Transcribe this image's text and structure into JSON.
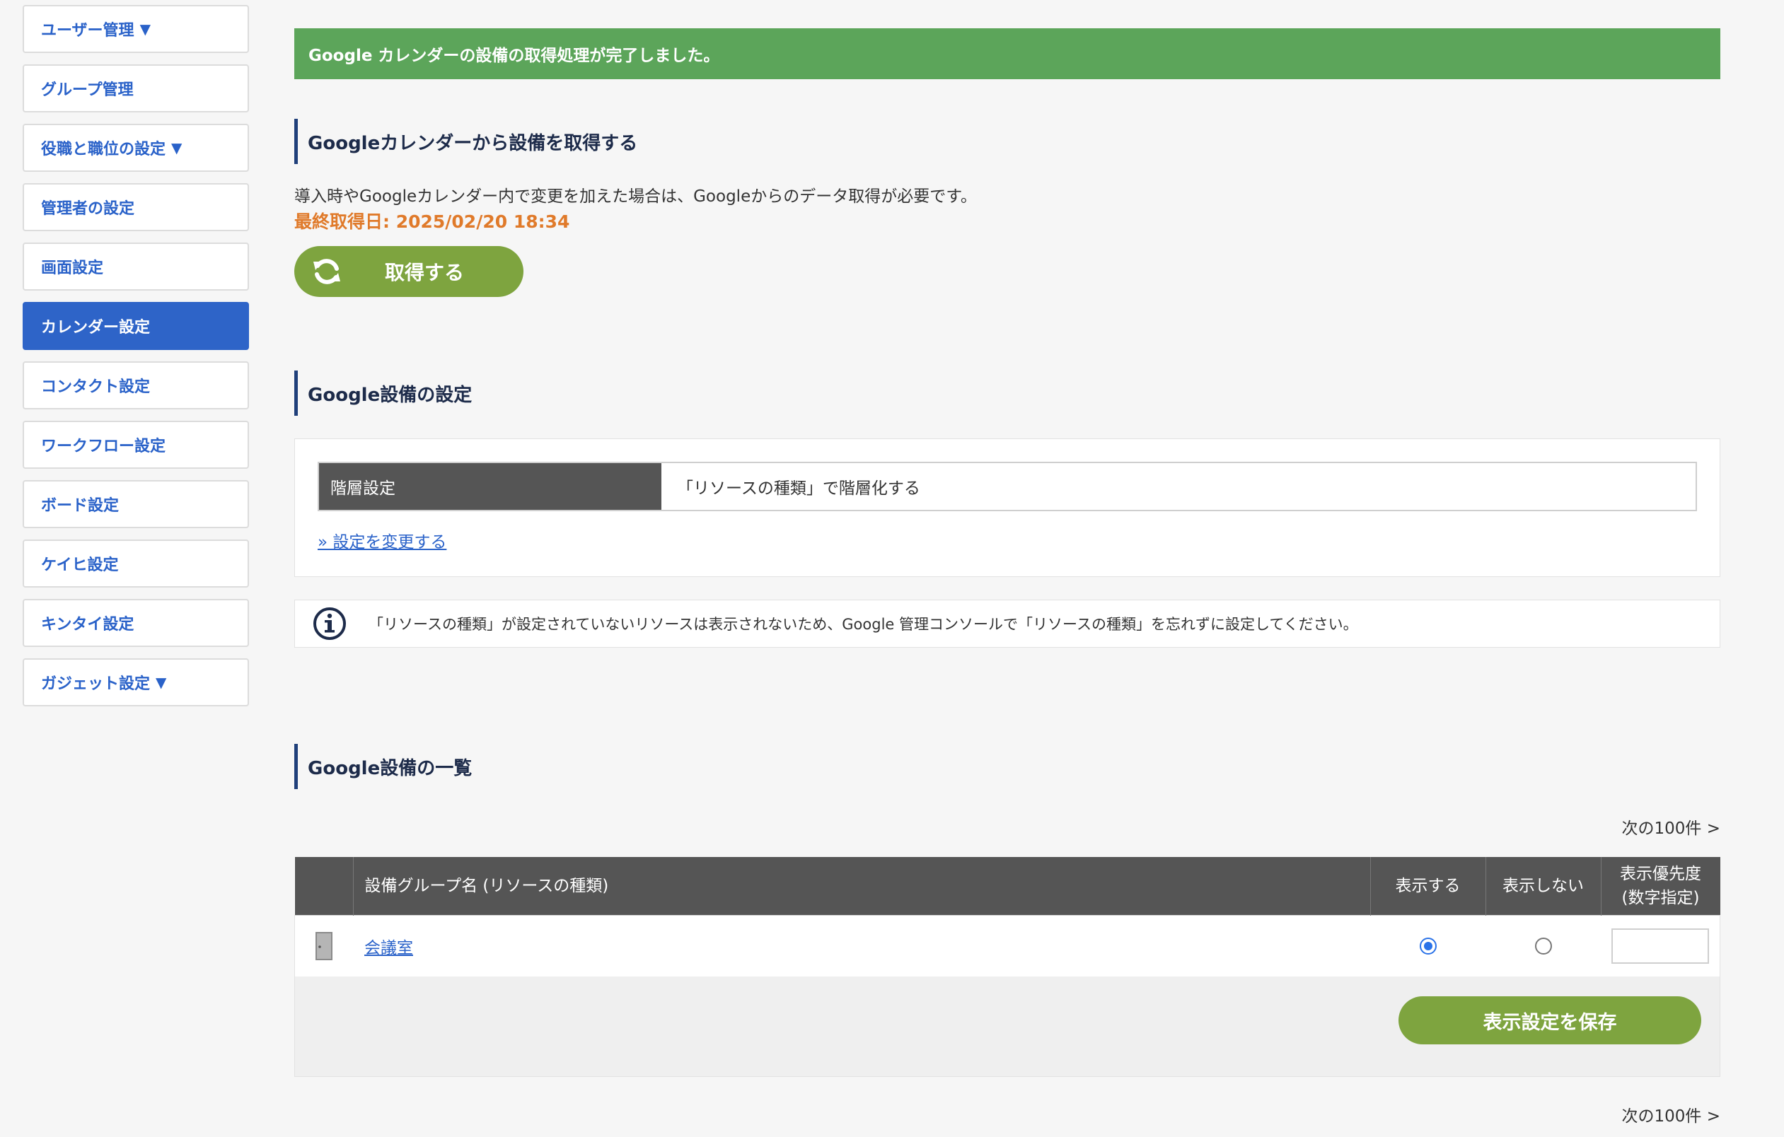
{
  "sidebar": {
    "items": [
      {
        "label": "ユーザー管理",
        "caret": "▼"
      },
      {
        "label": "グループ管理",
        "caret": ""
      },
      {
        "label": "役職と職位の設定",
        "caret": "▼"
      },
      {
        "label": "管理者の設定",
        "caret": ""
      },
      {
        "label": "画面設定",
        "caret": ""
      },
      {
        "label": "カレンダー設定",
        "caret": "",
        "active": true
      },
      {
        "label": "コンタクト設定",
        "caret": ""
      },
      {
        "label": "ワークフロー設定",
        "caret": ""
      },
      {
        "label": "ボード設定",
        "caret": ""
      },
      {
        "label": "ケイヒ設定",
        "caret": ""
      },
      {
        "label": "キンタイ設定",
        "caret": ""
      },
      {
        "label": "ガジェット設定",
        "caret": "▼"
      }
    ]
  },
  "banner": {
    "message": "Google カレンダーの設備の取得処理が完了しました。",
    "color": "#5ca55a"
  },
  "fetch_section": {
    "title": "Googleカレンダーから設備を取得する",
    "description": "導入時やGoogleカレンダー内で変更を加えた場合は、Googleからのデータ取得が必要です。",
    "last_fetched": "最終取得日: 2025/02/20 18:34",
    "button_label": "取得する",
    "button_icon": "sync-icon"
  },
  "settings_section": {
    "title": "Google設備の設定",
    "hierarchy_label": "階層設定",
    "hierarchy_value": "「リソースの種類」で階層化する",
    "change_link": "» 設定を変更する"
  },
  "info": {
    "icon": "info-icon",
    "message": "「リソースの種類」が設定されていないリソースは表示されないため、Google 管理コンソールで「リソースの種類」を忘れずに設定してください。"
  },
  "list_section": {
    "title": "Google設備の一覧",
    "pager_next": "次の100件 >",
    "columns": {
      "name": "設備グループ名 (リソースの種類)",
      "show": "表示する",
      "hide": "表示しない",
      "priority_line1": "表示優先度",
      "priority_line2": "(数字指定)"
    },
    "rows": [
      {
        "name": "会議室",
        "icon": "door-icon",
        "display": "show",
        "priority": ""
      }
    ],
    "save_button": "表示設定を保存"
  },
  "colors": {
    "accent_blue": "#2e64c8",
    "green_button": "#7ea43f",
    "orange_text": "#e07a2a"
  }
}
